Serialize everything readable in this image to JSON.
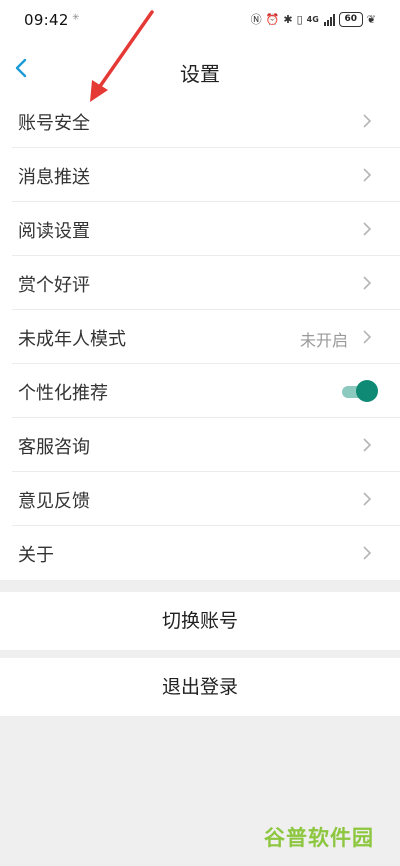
{
  "status_bar": {
    "time": "09:42",
    "dot": "✳",
    "network": "4G",
    "battery": "60"
  },
  "header": {
    "title": "设置"
  },
  "settings": {
    "items": [
      {
        "label": "账号安全",
        "value": ""
      },
      {
        "label": "消息推送",
        "value": ""
      },
      {
        "label": "阅读设置",
        "value": ""
      },
      {
        "label": "赏个好评",
        "value": ""
      },
      {
        "label": "未成年人模式",
        "value": "未开启"
      },
      {
        "label": "个性化推荐",
        "toggle_on": true
      },
      {
        "label": "客服咨询",
        "value": ""
      },
      {
        "label": "意见反馈",
        "value": ""
      },
      {
        "label": "关于",
        "value": ""
      }
    ]
  },
  "actions": {
    "switch_account": "切换账号",
    "logout": "退出登录"
  },
  "watermark": "谷普软件园",
  "colors": {
    "accent": "#0f8a74",
    "back_arrow": "#1a9bd8",
    "annotation_arrow": "#e53935",
    "watermark": "#8dc63f"
  }
}
